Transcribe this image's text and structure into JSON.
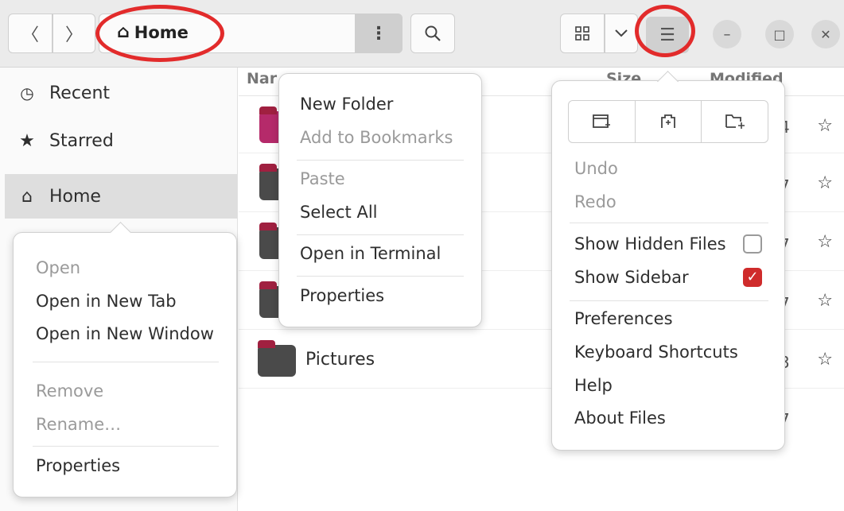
{
  "header": {
    "path_label": "Home",
    "back_icon": "chevron-left-icon",
    "forward_icon": "chevron-right-icon",
    "menu_dots": "⋮",
    "search_icon": "search-icon",
    "view_icon": "grid-icon",
    "view_dropdown": "chevron-down-icon",
    "main_menu_icon": "☰",
    "minimize": "–",
    "maximize": "□",
    "close": "✕"
  },
  "sidebar": {
    "items": [
      {
        "icon": "🕐",
        "label": "Recent"
      },
      {
        "icon": "★",
        "label": "Starred"
      },
      {
        "icon": "⌂",
        "label": "Home"
      }
    ]
  },
  "columns": {
    "name": "Nar",
    "size": "Size",
    "modified": "Modified"
  },
  "files": [
    {
      "name": "Pictures",
      "date_digit": "3"
    }
  ],
  "row_digits": [
    "4",
    "7",
    "7",
    "7",
    "3",
    "7"
  ],
  "path_menu": {
    "items": [
      {
        "label": "New Folder",
        "enabled": true
      },
      {
        "label": "Add to Bookmarks",
        "enabled": false
      },
      {
        "label": "Paste",
        "enabled": false
      },
      {
        "label": "Select All",
        "enabled": true
      },
      {
        "label": "Open in Terminal",
        "enabled": true
      },
      {
        "label": "Properties",
        "enabled": true
      }
    ]
  },
  "sidebar_menu": {
    "items": [
      {
        "label": "Open",
        "enabled": false
      },
      {
        "label": "Open in New Tab",
        "enabled": true
      },
      {
        "label": "Open in New Window",
        "enabled": true
      },
      {
        "label": "Remove",
        "enabled": false
      },
      {
        "label": "Rename…",
        "enabled": false
      },
      {
        "label": "Properties",
        "enabled": true
      }
    ]
  },
  "main_menu": {
    "icon_buttons": [
      "new-window-icon",
      "new-tab-icon",
      "new-folder-icon"
    ],
    "undo": "Undo",
    "redo": "Redo",
    "show_hidden_files": "Show Hidden Files",
    "show_hidden_checked": false,
    "show_sidebar": "Show Sidebar",
    "show_sidebar_checked": true,
    "preferences": "Preferences",
    "keyboard_shortcuts": "Keyboard Shortcuts",
    "help": "Help",
    "about": "About Files"
  },
  "colors": {
    "accent": "#cf2b2b",
    "annotation": "#e22b2b"
  }
}
